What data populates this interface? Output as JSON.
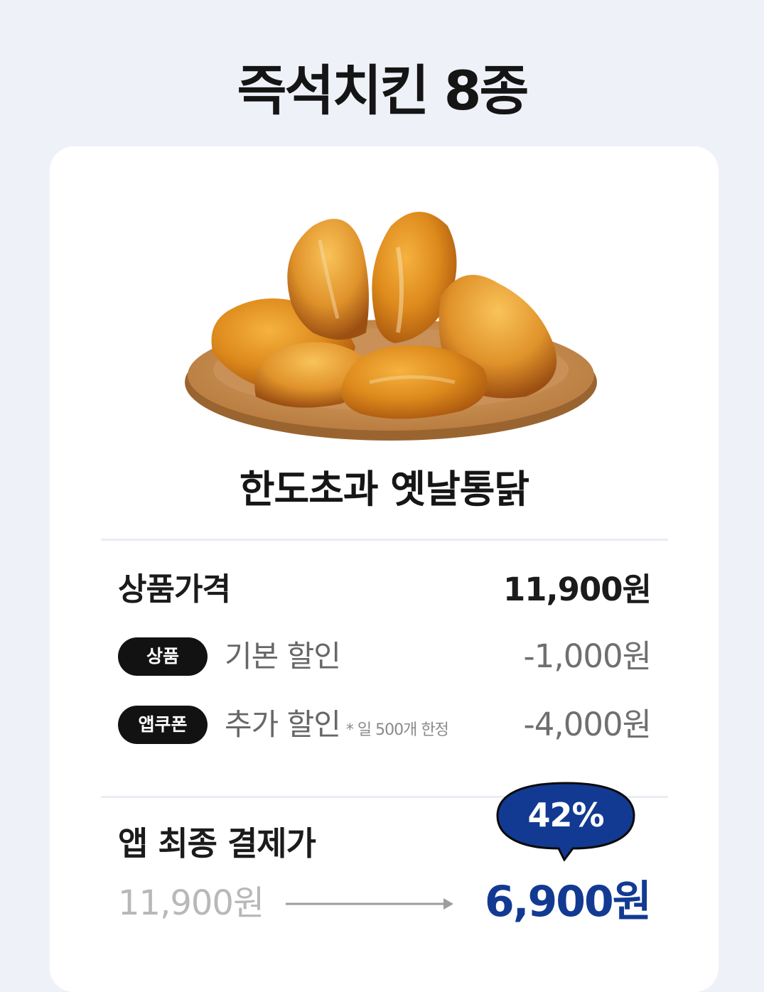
{
  "page_title": "즉석치킨 8종",
  "product": {
    "name": "한도초과 옛날통닭",
    "image_alt": "fried-chicken-on-wooden-plate"
  },
  "price": {
    "label": "상품가격",
    "value": "11,900원"
  },
  "discounts": [
    {
      "badge": "상품",
      "label": "기본 할인",
      "note": "",
      "value": "-1,000원"
    },
    {
      "badge": "앱쿠폰",
      "label": "추가 할인",
      "note": "* 일 500개 한정",
      "value": "-4,000원"
    }
  ],
  "final": {
    "label": "앱 최종 결제가",
    "original_price": "11,900원",
    "price": "6,900원",
    "discount_rate": "42%"
  },
  "colors": {
    "background": "#eef2f8",
    "card": "#ffffff",
    "accent": "#123a92",
    "badge": "#121212"
  }
}
